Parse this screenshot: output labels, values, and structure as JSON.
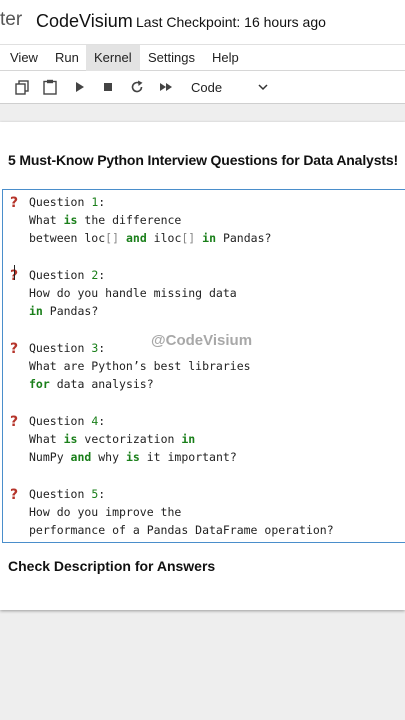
{
  "header": {
    "brand_fragment": "ter",
    "notebook_title": "CodeVisium",
    "checkpoint": "Last Checkpoint: 16 hours ago"
  },
  "menu": [
    "View",
    "Run",
    "Kernel",
    "Settings",
    "Help"
  ],
  "menu_active": "Kernel",
  "toolbar": {
    "icons": [
      "copy-icon",
      "paste-icon",
      "run-icon",
      "stop-icon",
      "restart-icon",
      "fast-forward-icon"
    ],
    "cell_type": "Code"
  },
  "notebook": {
    "heading": "5 Must-Know Python Interview Questions for Data Analysts!",
    "watermark": "@CodeVisium",
    "footer": "Check Description for Answers",
    "questions": [
      {
        "label": "Question",
        "number": "1",
        "colon": ":",
        "lines": [
          [
            [
              "What ",
              ""
            ],
            [
              "is",
              "kw"
            ],
            [
              " the difference",
              ""
            ]
          ],
          [
            [
              "between loc",
              ""
            ],
            [
              "[]",
              "pun"
            ],
            [
              " ",
              ""
            ],
            [
              "and",
              "kw"
            ],
            [
              " iloc",
              ""
            ],
            [
              "[]",
              "pun"
            ],
            [
              " ",
              ""
            ],
            [
              "in",
              "kw"
            ],
            [
              " Pandas?",
              ""
            ]
          ]
        ]
      },
      {
        "label": "Question",
        "number": "2",
        "colon": ":",
        "lines": [
          [
            [
              "How do you handle missing data",
              ""
            ]
          ],
          [
            [
              "in",
              "kw"
            ],
            [
              " Pandas?",
              ""
            ]
          ]
        ]
      },
      {
        "label": "Question",
        "number": "3",
        "colon": ":",
        "lines": [
          [
            [
              "What are Python’s best libraries",
              ""
            ]
          ],
          [
            [
              "for",
              "kw"
            ],
            [
              " data analysis?",
              ""
            ]
          ]
        ]
      },
      {
        "label": "Question",
        "number": "4",
        "colon": ":",
        "lines": [
          [
            [
              "What ",
              ""
            ],
            [
              "is",
              "kw"
            ],
            [
              " vectorization ",
              ""
            ],
            [
              "in",
              "kw"
            ]
          ],
          [
            [
              "NumPy ",
              ""
            ],
            [
              "and",
              "kw"
            ],
            [
              " why ",
              ""
            ],
            [
              "is",
              "kw"
            ],
            [
              " it important?",
              ""
            ]
          ]
        ]
      },
      {
        "label": "Question",
        "number": "5",
        "colon": ":",
        "lines": [
          [
            [
              "How do you improve the",
              ""
            ]
          ],
          [
            [
              "performance of a Pandas DataFrame operation?",
              ""
            ]
          ]
        ]
      }
    ]
  },
  "colors": {
    "keyword": "#1a7f1a",
    "question_mark": "#b5342a",
    "cell_border": "#4a8ecb"
  }
}
